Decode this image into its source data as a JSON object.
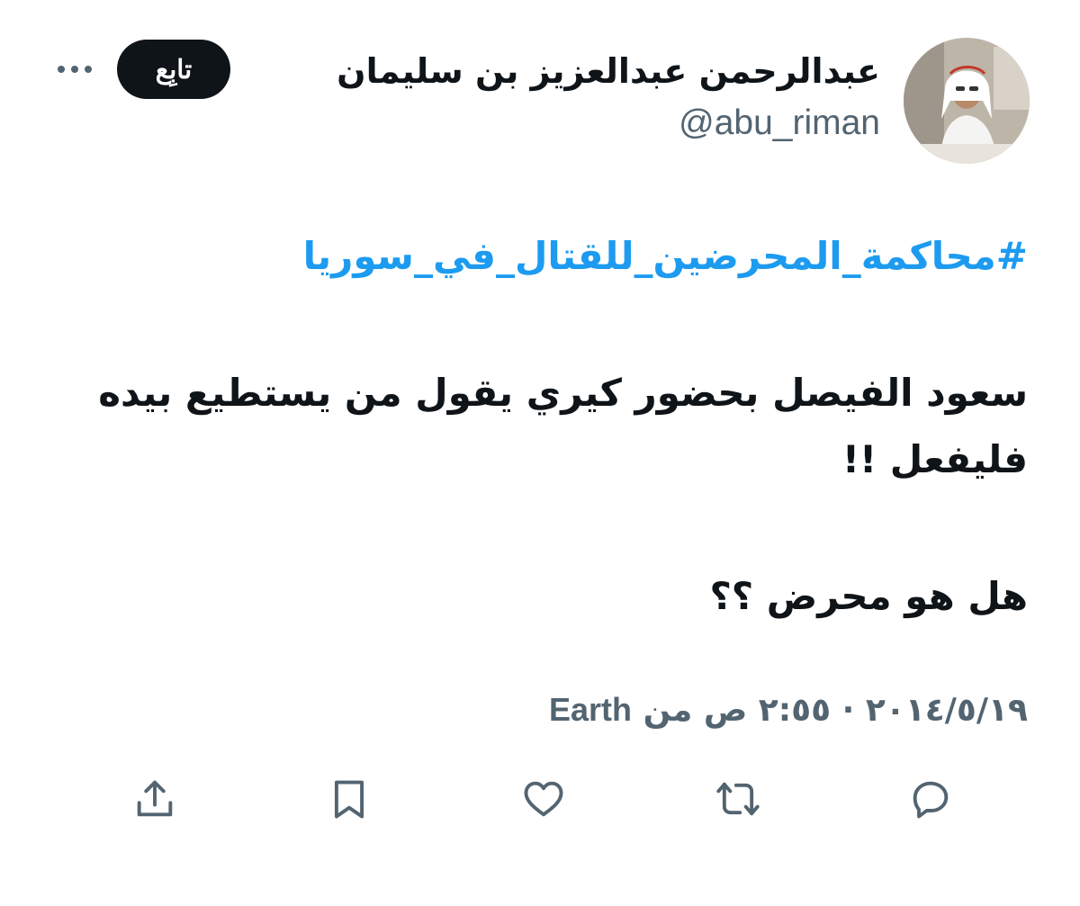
{
  "author": {
    "display_name": "عبدالرحمن عبدالعزيز بن سليمان",
    "handle": "@abu_riman",
    "avatar_icon": "profile-photo"
  },
  "header": {
    "follow_label": "تابِع",
    "more_icon": "more-horizontal-icon"
  },
  "tweet": {
    "hashtag": "#محاكمة_المحرضين_للقتال_في_سوريا",
    "paragraph_1": "سعود الفيصل بحضور كيري يقول من يستطيع بيده فليفعل !!",
    "paragraph_2": "هل هو محرض ؟؟"
  },
  "meta": {
    "date": "٢٠١٤/٥/١٩",
    "separator": "·",
    "time": "٢:٥٥ ص",
    "from_word": "من",
    "source": "Earth"
  },
  "actions": [
    {
      "name": "reply",
      "icon": "reply-icon"
    },
    {
      "name": "retweet",
      "icon": "retweet-icon"
    },
    {
      "name": "like",
      "icon": "heart-icon"
    },
    {
      "name": "bookmark",
      "icon": "bookmark-icon"
    },
    {
      "name": "share",
      "icon": "share-icon"
    }
  ],
  "colors": {
    "text": "#0f1419",
    "secondary": "#536471",
    "hashtag": "#1d9bf0",
    "follow_bg": "#0f1419"
  }
}
